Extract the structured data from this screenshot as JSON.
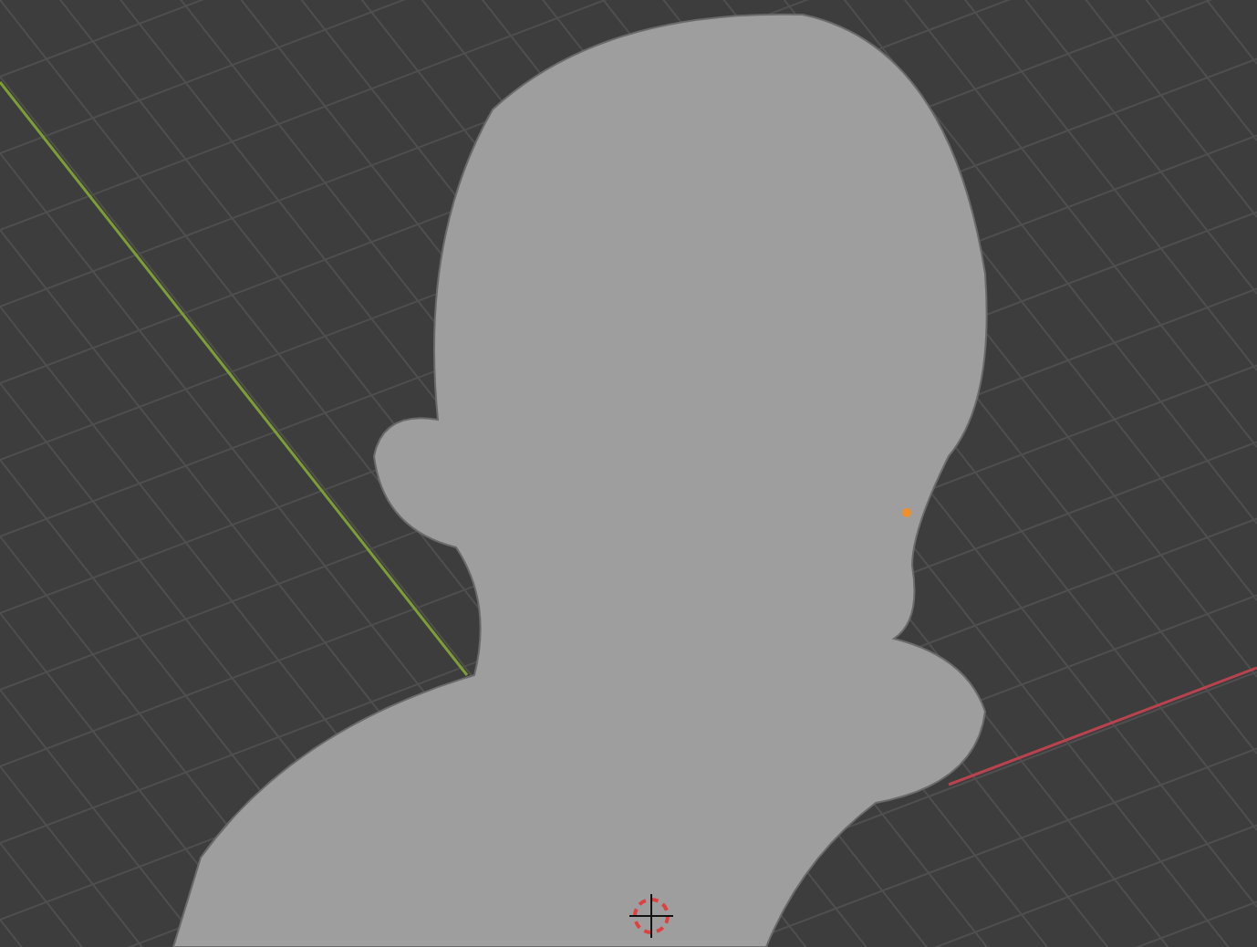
{
  "viewport": {
    "axes": [
      {
        "kind": "x",
        "color": "#b8434f"
      },
      {
        "kind": "y",
        "color": "#7d9e35"
      }
    ]
  }
}
